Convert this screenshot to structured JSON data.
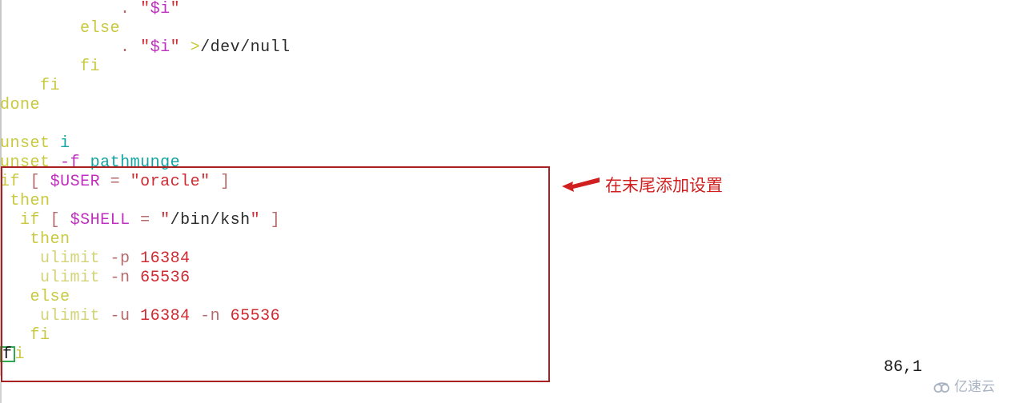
{
  "editor": {
    "status_position": "86,1",
    "cursor_char": "f",
    "colors": {
      "keyword": "#c9c93f",
      "variable": "#c030c0",
      "string": "#cf2b33",
      "identifier": "#14a3a3",
      "punctuation": "#b56b6b",
      "plain": "#2b2b2b",
      "cursor_outline": "#2fa84f",
      "highlight_box": "#a82020",
      "annotation": "#d01f1f",
      "background": "#ffffff"
    },
    "lines": [
      {
        "indent": "            ",
        "tokens": [
          {
            "t": ".",
            "c": "punct"
          },
          {
            "t": " ",
            "c": "plain"
          },
          {
            "t": "\"$i\"",
            "c": "var-str"
          }
        ]
      },
      {
        "indent": "        ",
        "tokens": [
          {
            "t": "else",
            "c": "kw"
          }
        ]
      },
      {
        "indent": "            ",
        "tokens": [
          {
            "t": ".",
            "c": "punct"
          },
          {
            "t": " ",
            "c": "plain"
          },
          {
            "t": "\"$i\"",
            "c": "var-str"
          },
          {
            "t": " ",
            "c": "plain"
          },
          {
            "t": ">",
            "c": "redir"
          },
          {
            "t": "/dev/null",
            "c": "plain"
          }
        ]
      },
      {
        "indent": "        ",
        "tokens": [
          {
            "t": "fi",
            "c": "kw"
          }
        ]
      },
      {
        "indent": "    ",
        "tokens": [
          {
            "t": "fi",
            "c": "kw"
          }
        ]
      },
      {
        "indent": "",
        "tokens": [
          {
            "t": "done",
            "c": "kw"
          }
        ]
      },
      {
        "indent": "",
        "tokens": []
      },
      {
        "indent": "",
        "tokens": [
          {
            "t": "unset",
            "c": "kw"
          },
          {
            "t": " ",
            "c": "plain"
          },
          {
            "t": "i",
            "c": "ident"
          }
        ]
      },
      {
        "indent": "",
        "tokens": [
          {
            "t": "unset",
            "c": "kw"
          },
          {
            "t": " ",
            "c": "plain"
          },
          {
            "t": "-f",
            "c": "var"
          },
          {
            "t": " ",
            "c": "plain"
          },
          {
            "t": "pathmunge",
            "c": "ident"
          }
        ]
      },
      {
        "indent": "",
        "tokens": [
          {
            "t": "if",
            "c": "kw"
          },
          {
            "t": " ",
            "c": "plain"
          },
          {
            "t": "[",
            "c": "punct"
          },
          {
            "t": " ",
            "c": "plain"
          },
          {
            "t": "$USER",
            "c": "var"
          },
          {
            "t": " ",
            "c": "plain"
          },
          {
            "t": "=",
            "c": "punct"
          },
          {
            "t": " ",
            "c": "plain"
          },
          {
            "t": "\"oracle\"",
            "c": "str"
          },
          {
            "t": " ",
            "c": "plain"
          },
          {
            "t": "]",
            "c": "punct"
          }
        ]
      },
      {
        "indent": " ",
        "tokens": [
          {
            "t": "then",
            "c": "kw"
          }
        ]
      },
      {
        "indent": "  ",
        "tokens": [
          {
            "t": "if",
            "c": "kw"
          },
          {
            "t": " ",
            "c": "plain"
          },
          {
            "t": "[",
            "c": "punct"
          },
          {
            "t": " ",
            "c": "plain"
          },
          {
            "t": "$SHELL",
            "c": "var"
          },
          {
            "t": " ",
            "c": "plain"
          },
          {
            "t": "=",
            "c": "punct"
          },
          {
            "t": " ",
            "c": "plain"
          },
          {
            "t": "\"",
            "c": "quote"
          },
          {
            "t": "/bin/ksh",
            "c": "plain"
          },
          {
            "t": "\"",
            "c": "quote"
          },
          {
            "t": " ",
            "c": "plain"
          },
          {
            "t": "]",
            "c": "punct"
          }
        ]
      },
      {
        "indent": "   ",
        "tokens": [
          {
            "t": "then",
            "c": "kw"
          }
        ]
      },
      {
        "indent": "    ",
        "tokens": [
          {
            "t": "ulimit",
            "c": "kw-soft"
          },
          {
            "t": " ",
            "c": "plain"
          },
          {
            "t": "-p",
            "c": "opt"
          },
          {
            "t": " ",
            "c": "plain"
          },
          {
            "t": "16384",
            "c": "num"
          }
        ]
      },
      {
        "indent": "    ",
        "tokens": [
          {
            "t": "ulimit",
            "c": "kw-soft"
          },
          {
            "t": " ",
            "c": "plain"
          },
          {
            "t": "-n",
            "c": "opt"
          },
          {
            "t": " ",
            "c": "plain"
          },
          {
            "t": "65536",
            "c": "num"
          }
        ]
      },
      {
        "indent": "   ",
        "tokens": [
          {
            "t": "else",
            "c": "kw"
          }
        ]
      },
      {
        "indent": "    ",
        "tokens": [
          {
            "t": "ulimit",
            "c": "kw-soft"
          },
          {
            "t": " ",
            "c": "plain"
          },
          {
            "t": "-u",
            "c": "opt"
          },
          {
            "t": " ",
            "c": "plain"
          },
          {
            "t": "16384",
            "c": "num"
          },
          {
            "t": " ",
            "c": "plain"
          },
          {
            "t": "-n",
            "c": "opt"
          },
          {
            "t": " ",
            "c": "plain"
          },
          {
            "t": "65536",
            "c": "num"
          }
        ]
      },
      {
        "indent": "   ",
        "tokens": [
          {
            "t": "fi",
            "c": "kw"
          }
        ]
      },
      {
        "indent": "",
        "tokens": [
          {
            "t": "f",
            "c": "cursor"
          },
          {
            "t": "i",
            "c": "kw"
          }
        ]
      }
    ]
  },
  "annotation": {
    "text": "在末尾添加设置",
    "arrow": "arrow-left"
  },
  "watermark": {
    "text": "亿速云",
    "icon": "cloud-swirl-icon"
  }
}
